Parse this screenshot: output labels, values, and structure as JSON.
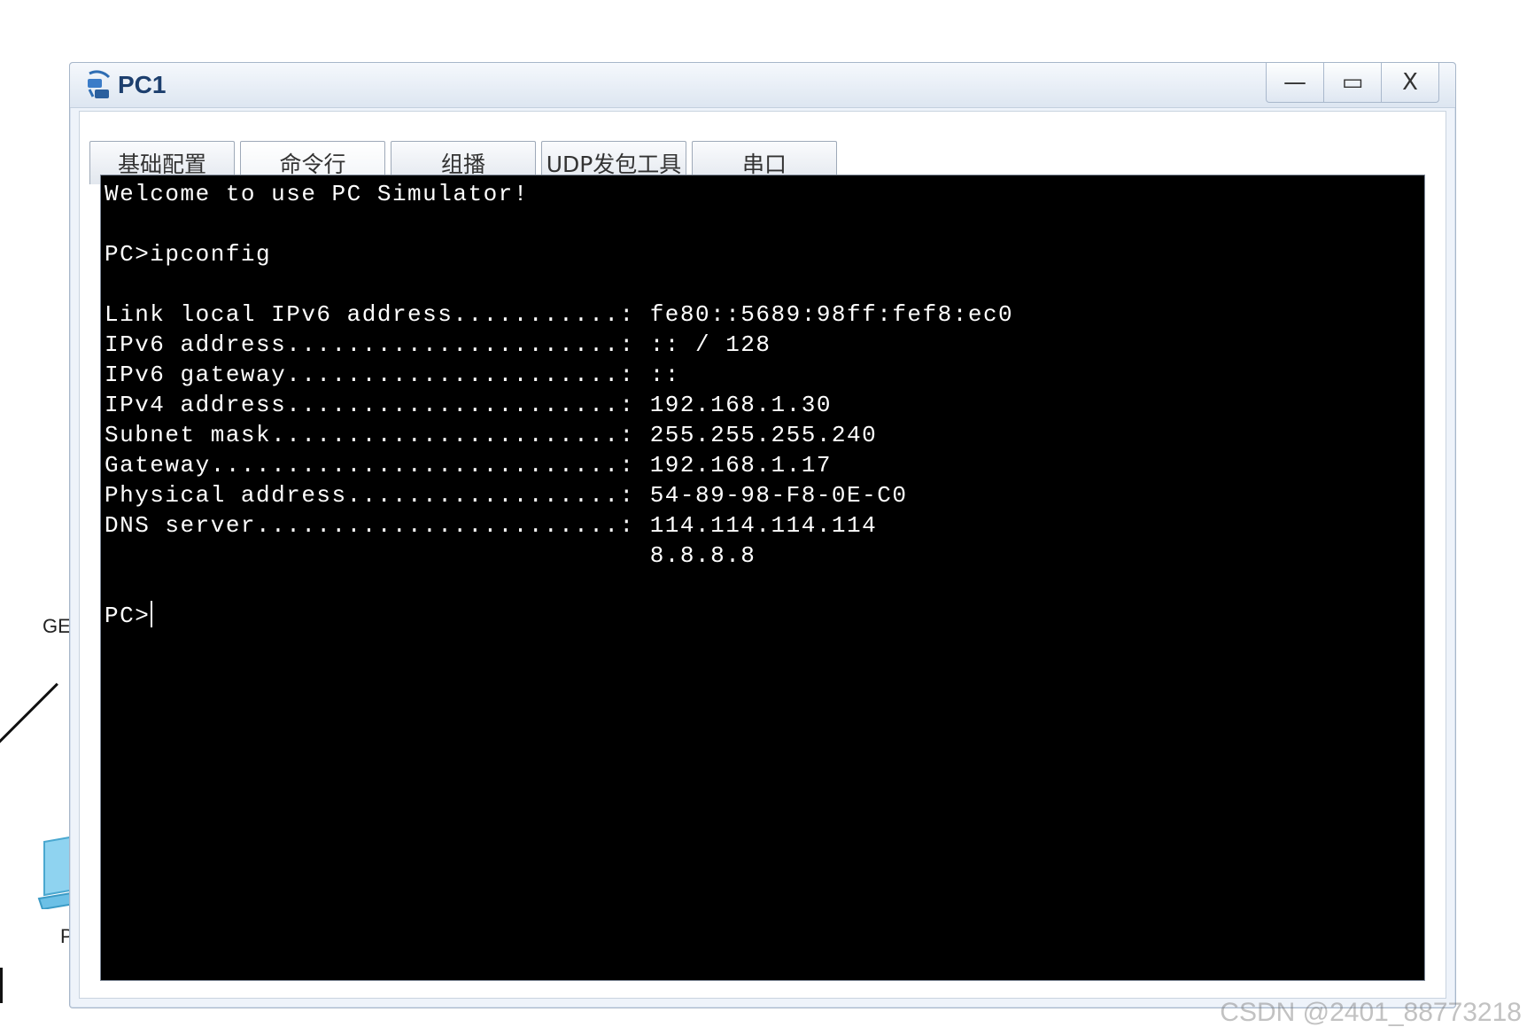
{
  "background": {
    "port_label": "GE",
    "device_label": "P"
  },
  "window": {
    "title": "PC1",
    "controls": {
      "minimize": "—",
      "maximize": "▭",
      "close": "X"
    }
  },
  "tabs": [
    {
      "label": "基础配置",
      "active": false
    },
    {
      "label": "命令行",
      "active": true
    },
    {
      "label": "组播",
      "active": false
    },
    {
      "label": "UDP发包工具",
      "active": false
    },
    {
      "label": "串口",
      "active": false
    }
  ],
  "terminal": {
    "lines": [
      "Welcome to use PC Simulator!",
      "",
      "PC>ipconfig",
      "",
      "Link local IPv6 address...........: fe80::5689:98ff:fef8:ec0",
      "IPv6 address......................: :: / 128",
      "IPv6 gateway......................: ::",
      "IPv4 address......................: 192.168.1.30",
      "Subnet mask.......................: 255.255.255.240",
      "Gateway...........................: 192.168.1.17",
      "Physical address..................: 54-89-98-F8-0E-C0",
      "DNS server........................: 114.114.114.114",
      "                                    8.8.8.8",
      "",
      "PC>"
    ]
  },
  "watermark": "CSDN @2401_88773218"
}
